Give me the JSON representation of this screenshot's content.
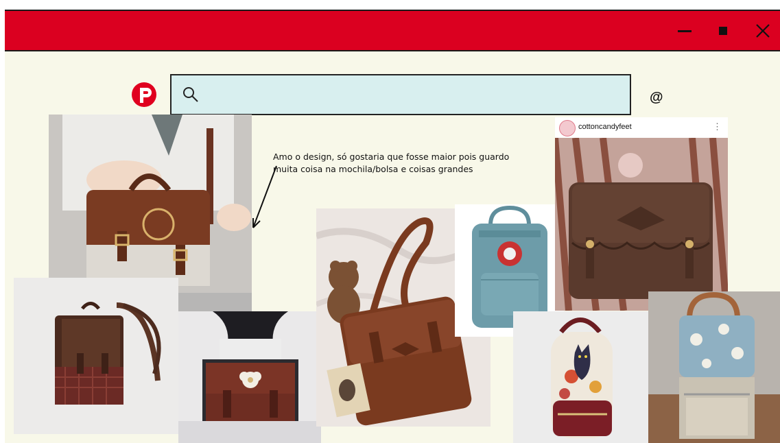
{
  "window": {
    "minimize_icon": "minimize-icon",
    "maximize_icon": "maximize-icon",
    "close_icon": "close-icon",
    "accent_color": "#db0020",
    "background_color": "#f8f8e9"
  },
  "header": {
    "logo_icon": "pinterest-logo-icon",
    "search_icon": "search-icon",
    "search_value": "",
    "search_placeholder": "",
    "at_symbol": "@"
  },
  "board": {
    "note_text": "Amo o design, só gostaria que fosse maior pois guardo muita coisa na mochila/bolsa e coisas grandes",
    "instagram_username": "cottoncandyfeet",
    "instagram_menu_glyph": "⋮"
  }
}
